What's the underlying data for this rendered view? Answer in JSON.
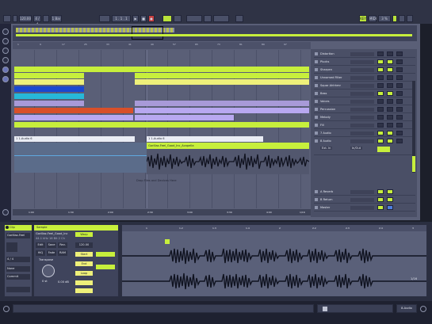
{
  "transport": {
    "tempo": "120.00",
    "meter": "4 / 4",
    "quantize": "1 Bar",
    "position": "1 . 1 . 1",
    "mode_key": "KEY",
    "mode_midi": "MIDI",
    "cpu": "3 %"
  },
  "arrangement": {
    "ruler_marks": [
      "1",
      "9",
      "17",
      "25",
      "33",
      "41",
      "49",
      "57",
      "65",
      "73",
      "81",
      "89",
      "97"
    ],
    "clip_labels": [
      "1 1-Audio 6",
      "1 1-Audio 6"
    ],
    "audio_clip_name": "Gorillaz-Feel_Good_Inc_Acapella",
    "drop_hint": "Drop Files and Devices Here",
    "bottom_times": [
      "1:00",
      "1:30",
      "2:00",
      "2:30",
      "3:00",
      "3:30",
      "4:00"
    ],
    "loop_readout": "1/16"
  },
  "tracks": [
    {
      "name": "Distortion",
      "active": false
    },
    {
      "name": "Plucks",
      "active": true
    },
    {
      "name": "Sharpen",
      "active": true
    },
    {
      "name": "Unnamed Filter",
      "active": false
    },
    {
      "name": "Squar Ahhhmr",
      "active": false
    },
    {
      "name": "Bass",
      "active": true
    },
    {
      "name": "Voices",
      "active": false
    },
    {
      "name": "Percussion",
      "active": false
    },
    {
      "name": "Melody",
      "active": false
    },
    {
      "name": "Fill",
      "active": false
    },
    {
      "name": "7 Audio",
      "active": true
    },
    {
      "name": "8 Audio",
      "active": true
    }
  ],
  "returns": [
    {
      "name": "A Reverb"
    },
    {
      "name": "B Return"
    },
    {
      "name": "Master"
    }
  ],
  "mixer_labels": {
    "in": "Ext. In",
    "io": "In/Out",
    "sends": "Sends",
    "master": "Master"
  },
  "detail": {
    "clip_title": "Clip",
    "clip_name": "Gorillaz-Feel",
    "sample_title": "Sample",
    "sample_name": "Gorillaz-Feel_Good_Inc",
    "sample_rate": "44.1 kHz 16 Bit 2 Ch",
    "warp": "Warp",
    "edit": "Edit",
    "save": "Save",
    "rev": "Rev.",
    "hiq": "HiQ",
    "fade": "Fade",
    "ram": "RAM",
    "transpose_label": "Transpose",
    "transpose_value": "0 st",
    "gain_value": "0.00 dB",
    "seg_bpm": "120.00",
    "signature": "4 / 4",
    "groove": "None",
    "commit": "Commit",
    "start": "Start",
    "end": "End",
    "loop": "Loop",
    "wave_ticks": [
      "1",
      "1.2",
      "1.3",
      "1.4",
      "2",
      "2.2",
      "2.3",
      "2.4",
      "3"
    ],
    "zoom": "1/16"
  },
  "status": {
    "track_name": "8-Audio"
  },
  "colors": {
    "accent": "#c7ef3c",
    "clip_green": "#c7ef3c",
    "clip_yellow": "#eef07a",
    "clip_blue": "#1a48d0",
    "clip_cyan": "#27b8d8",
    "clip_violet": "#a89ad8",
    "clip_red": "#d8502a",
    "clip_lavender": "#b8a8f0"
  }
}
